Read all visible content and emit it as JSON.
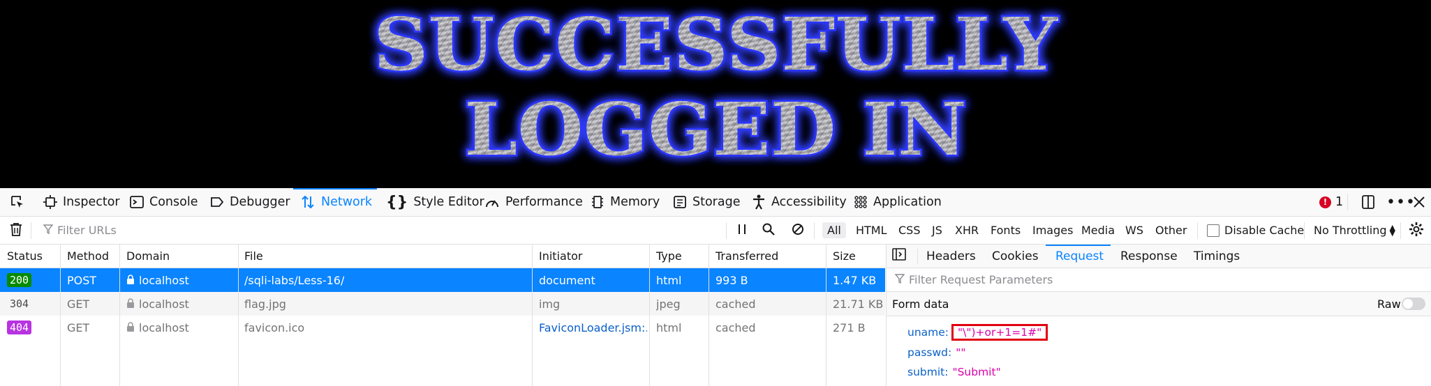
{
  "banner": {
    "line1": "SUCCESSFULLY",
    "line2": "LOGGED IN"
  },
  "colors": {
    "accent": "#0a84ff",
    "status_200": "#058b00",
    "status_404": "#b833e1",
    "highlight_box": "#e0000f",
    "param_value": "#dd00a9"
  },
  "toolbar": {
    "picker_icon": "element-picker-icon",
    "tabs": [
      {
        "label": "Inspector",
        "icon": "inspector-icon"
      },
      {
        "label": "Console",
        "icon": "console-icon"
      },
      {
        "label": "Debugger",
        "icon": "debugger-icon"
      },
      {
        "label": "Network",
        "icon": "network-arrows-icon",
        "selected": true
      },
      {
        "label": "Style Editor",
        "icon": "braces-icon"
      },
      {
        "label": "Performance",
        "icon": "gauge-icon"
      },
      {
        "label": "Memory",
        "icon": "memory-chip-icon"
      },
      {
        "label": "Storage",
        "icon": "storage-icon"
      },
      {
        "label": "Accessibility",
        "icon": "accessibility-icon"
      },
      {
        "label": "Application",
        "icon": "grid-icon"
      }
    ],
    "error_count": "1",
    "dock_icon": "dock-icon",
    "more_icon": "more-icon",
    "close_icon": "close-icon"
  },
  "filterbar": {
    "trash_icon": "trash-icon",
    "filter_placeholder": "Filter URLs",
    "pause_icon": "pause-icon",
    "search_icon": "search-icon",
    "block_icon": "block-icon",
    "types": [
      "All",
      "HTML",
      "CSS",
      "JS",
      "XHR",
      "Fonts",
      "Images",
      "Media",
      "WS",
      "Other"
    ],
    "disable_cache_label": "Disable Cache",
    "throttling_label": "No Throttling",
    "settings_icon": "gear-icon"
  },
  "table": {
    "columns": [
      "Status",
      "Method",
      "Domain",
      "File",
      "Initiator",
      "Type",
      "Transferred",
      "Size"
    ],
    "rows": [
      {
        "status": "200",
        "method": "POST",
        "domain": "localhost",
        "file": "/sqli-labs/Less-16/",
        "initiator": "document",
        "type": "html",
        "transferred": "993 B",
        "size": "1.47 KB"
      },
      {
        "status": "304",
        "method": "GET",
        "domain": "localhost",
        "file": "flag.jpg",
        "initiator": "img",
        "type": "jpeg",
        "transferred": "cached",
        "size": "21.71 KB"
      },
      {
        "status": "404",
        "method": "GET",
        "domain": "localhost",
        "file": "favicon.ico",
        "initiator": "FaviconLoader.jsm:...",
        "type": "html",
        "transferred": "cached",
        "size": "271 B"
      }
    ]
  },
  "side": {
    "tabs": [
      "Headers",
      "Cookies",
      "Request",
      "Response",
      "Timings"
    ],
    "selected_tab": "Request",
    "filter_placeholder": "Filter Request Parameters",
    "form_data_label": "Form data",
    "raw_label": "Raw",
    "params": [
      {
        "key": "uname:",
        "value": "\"\\\")+or+1=1#\""
      },
      {
        "key": "passwd:",
        "value": "\"\""
      },
      {
        "key": "submit:",
        "value": "\"Submit\""
      }
    ]
  }
}
